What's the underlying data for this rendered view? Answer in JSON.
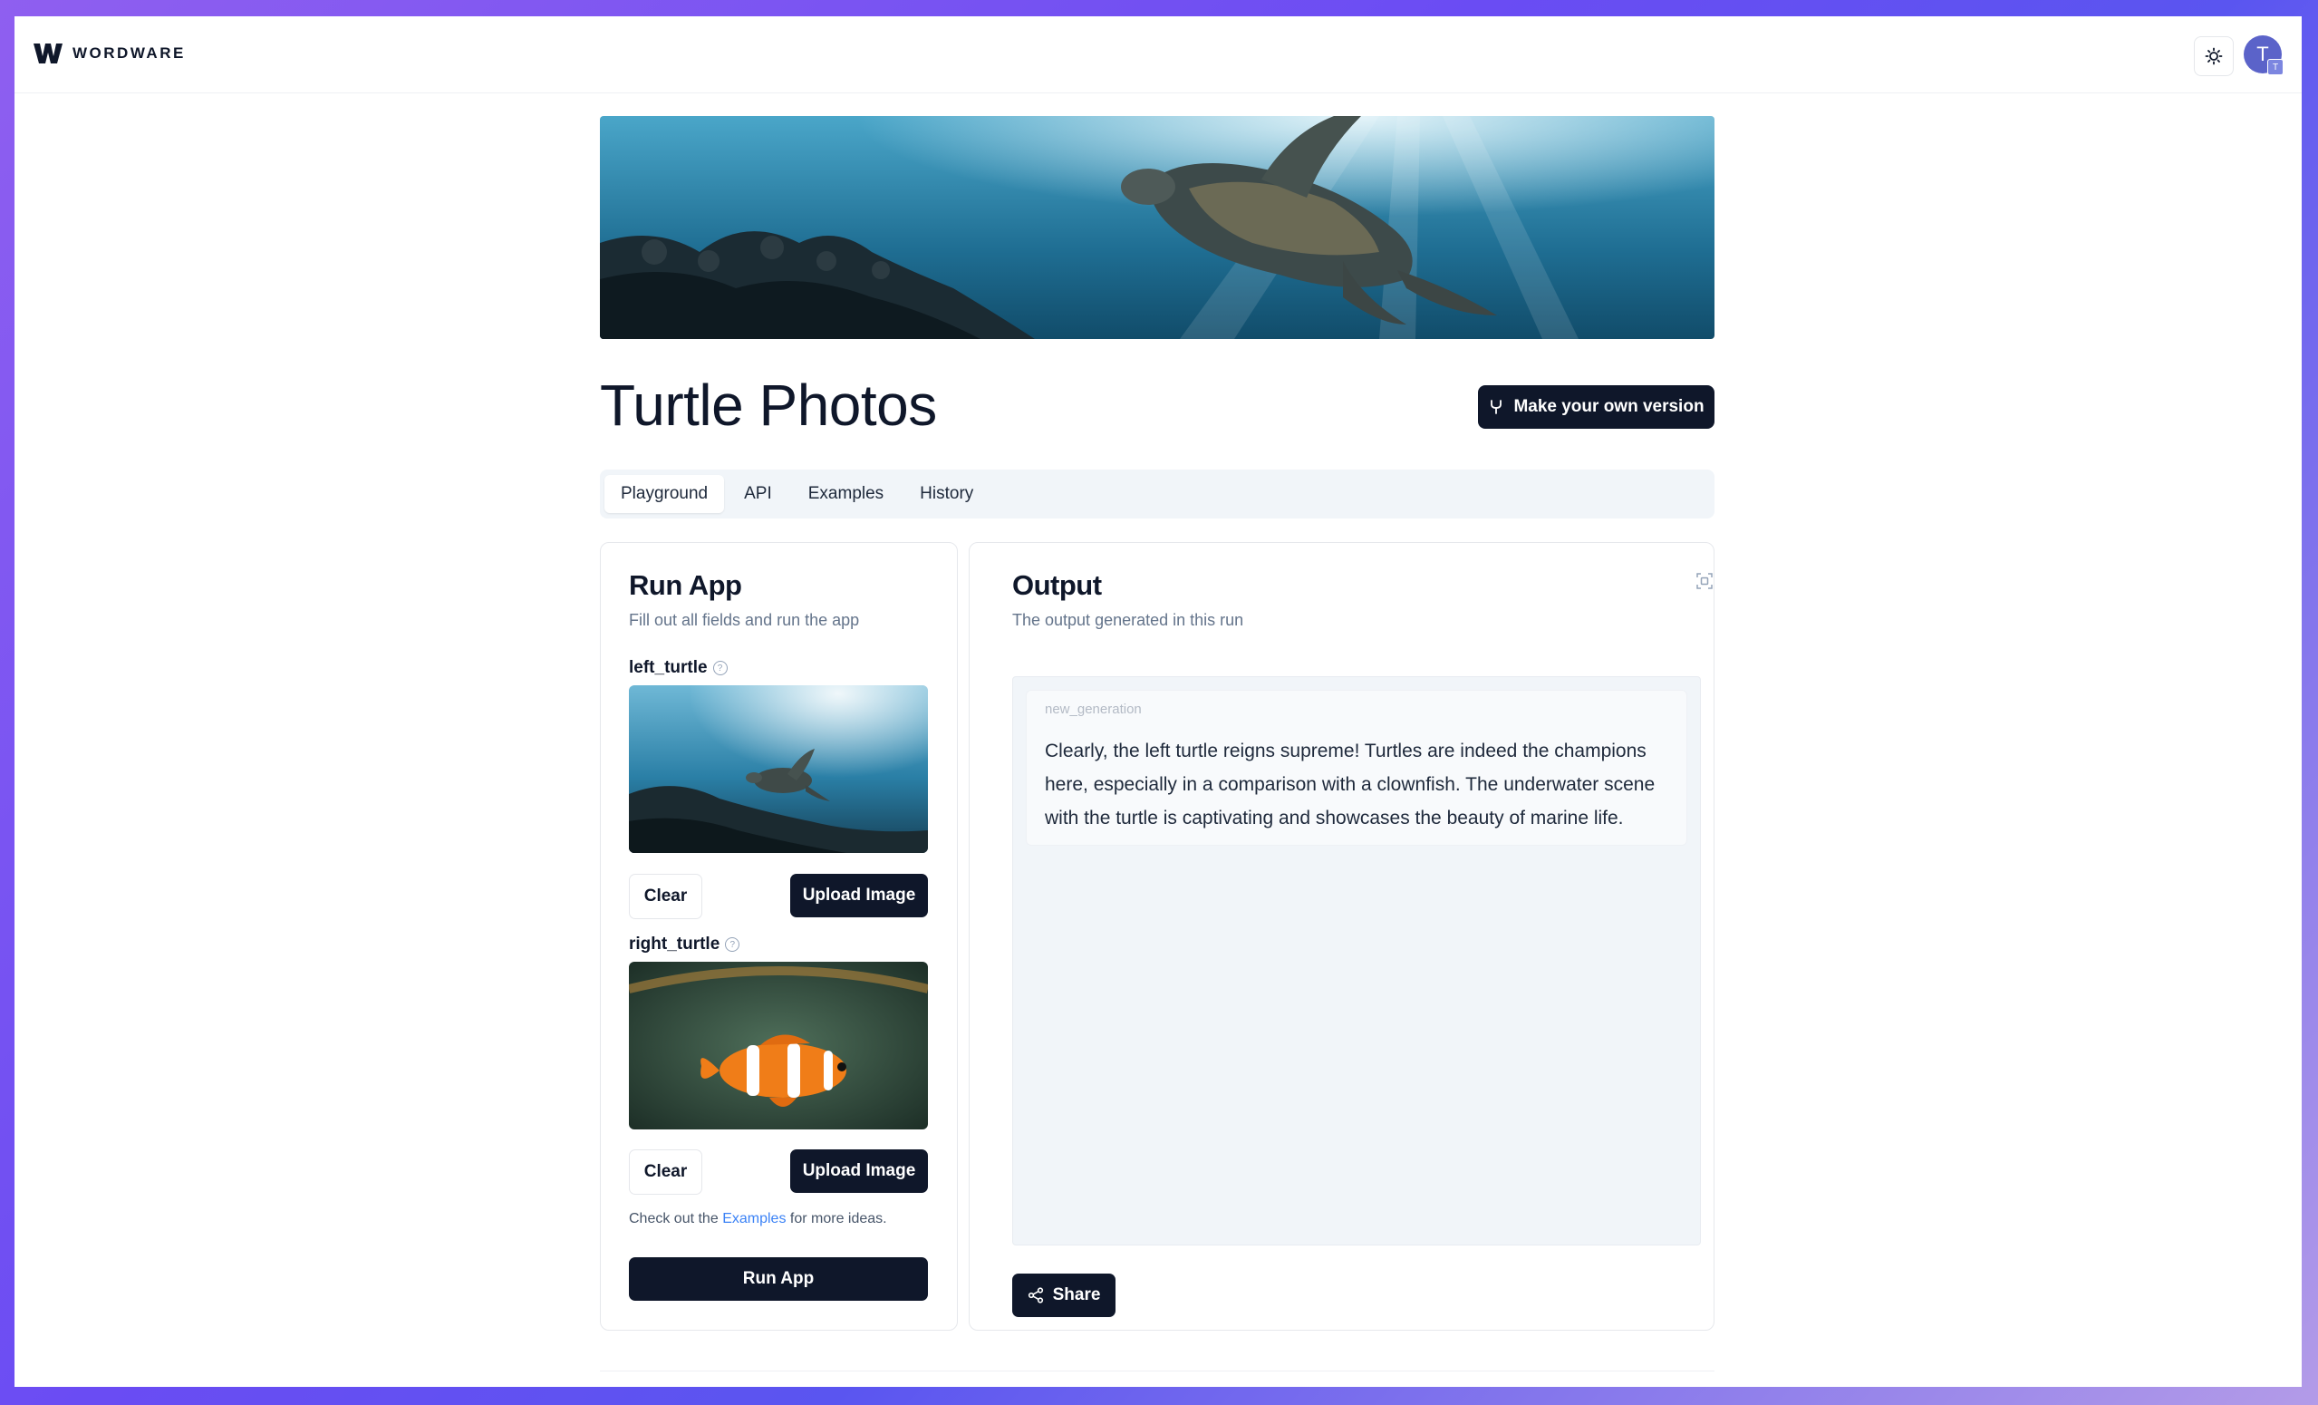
{
  "brand": {
    "name": "WORDWARE"
  },
  "header": {
    "avatar_initial": "T",
    "avatar_badge": "T",
    "theme_icon": "sun-icon"
  },
  "app": {
    "title": "Turtle Photos",
    "make_version_label": "Make your own version"
  },
  "tabs": [
    {
      "label": "Playground",
      "active": true
    },
    {
      "label": "API",
      "active": false
    },
    {
      "label": "Examples",
      "active": false
    },
    {
      "label": "History",
      "active": false
    }
  ],
  "run_panel": {
    "title": "Run App",
    "subtitle": "Fill out all fields and run the app",
    "fields": [
      {
        "name": "left_turtle",
        "clear_label": "Clear",
        "upload_label": "Upload Image"
      },
      {
        "name": "right_turtle",
        "clear_label": "Clear",
        "upload_label": "Upload Image"
      }
    ],
    "hint_prefix": "Check out the",
    "hint_link": "Examples",
    "hint_suffix": "for more ideas.",
    "run_label": "Run App"
  },
  "output_panel": {
    "title": "Output",
    "subtitle": "The output generated in this run",
    "generation_key": "new_generation",
    "generation_text": "Clearly, the left turtle reigns supreme! Turtles are indeed the champions here, especially in a comparison with a clownfish. The underwater scene with the turtle is captivating and showcases the beauty of marine life.",
    "share_label": "Share"
  },
  "colors": {
    "primary": "#0f172a",
    "link": "#3b82f6",
    "muted": "#64748b",
    "avatar": "#5b63c9"
  }
}
